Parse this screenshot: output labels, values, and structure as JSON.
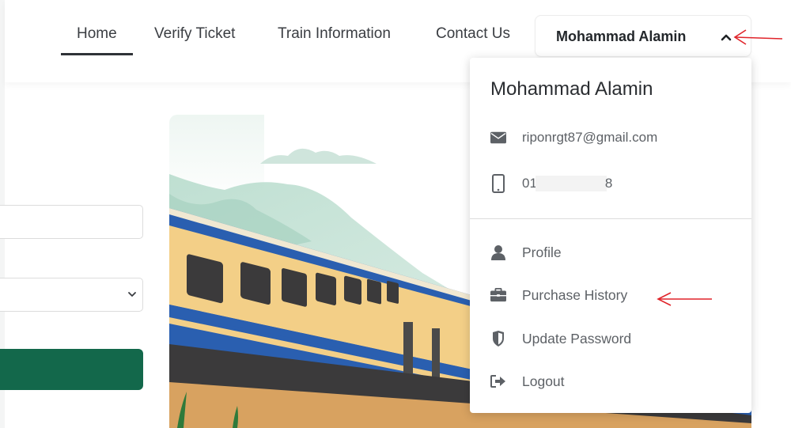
{
  "nav": {
    "items": [
      {
        "label": "Home",
        "active": true
      },
      {
        "label": "Verify Ticket",
        "active": false
      },
      {
        "label": "Train Information",
        "active": false
      },
      {
        "label": "Contact Us",
        "active": false
      }
    ],
    "user_toggle": {
      "name": "Mohammad Alamin",
      "icon": "chevron-up-icon",
      "expanded": true
    }
  },
  "user_menu": {
    "name": "Mohammad Alamin",
    "email": "riponrgt87@gmail.com",
    "email_icon": "envelope-icon",
    "phone_prefix": "01",
    "phone_suffix": "8",
    "phone_icon": "mobile-phone-icon",
    "items": [
      {
        "label": "Profile",
        "icon": "user-icon"
      },
      {
        "label": "Purchase History",
        "icon": "briefcase-icon"
      },
      {
        "label": "Update Password",
        "icon": "shield-icon"
      },
      {
        "label": "Logout",
        "icon": "sign-out-icon"
      }
    ]
  },
  "form": {
    "input_value": "",
    "select_value": "",
    "button_color": "#13684b"
  },
  "annotations": {
    "arrow_color": "#e0242a"
  },
  "colors": {
    "brand_green": "#13684b",
    "train_blue": "#2a5fb0",
    "train_yellow": "#f3cf87"
  }
}
